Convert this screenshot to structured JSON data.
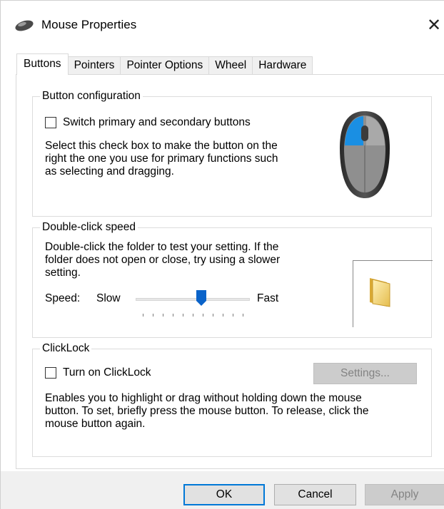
{
  "window": {
    "title": "Mouse Properties",
    "app_icon": "mouse-icon",
    "close_icon": "close-icon"
  },
  "tabs": [
    {
      "label": "Buttons",
      "active": true
    },
    {
      "label": "Pointers",
      "active": false
    },
    {
      "label": "Pointer Options",
      "active": false
    },
    {
      "label": "Wheel",
      "active": false
    },
    {
      "label": "Hardware",
      "active": false
    }
  ],
  "button_config": {
    "group_label": "Button configuration",
    "checkbox_label": "Switch primary and secondary buttons",
    "checked": false,
    "description_lines": [
      "Select this check box to make the button on the",
      "right the one you use for primary functions such",
      "as selecting and dragging."
    ],
    "highlight_color": "#1a8fe3"
  },
  "double_click": {
    "group_label": "Double-click speed",
    "description_lines": [
      "Double-click the folder to test your setting. If the",
      "folder does not open or close, try using a slower",
      "setting."
    ],
    "speed_label": "Speed:",
    "slow_label": "Slow",
    "fast_label": "Fast",
    "speed_level": 0.5,
    "thumb_color": "#0a63c9"
  },
  "clicklock": {
    "group_label": "ClickLock",
    "checkbox_label": "Turn on ClickLock",
    "checked": false,
    "settings_label": "Settings...",
    "description_lines": [
      "Enables you to highlight or drag without holding down the mouse",
      "button. To set, briefly press the mouse button. To release, click the",
      "mouse button again."
    ]
  },
  "buttons": {
    "ok": "OK",
    "cancel": "Cancel",
    "apply": "Apply"
  }
}
